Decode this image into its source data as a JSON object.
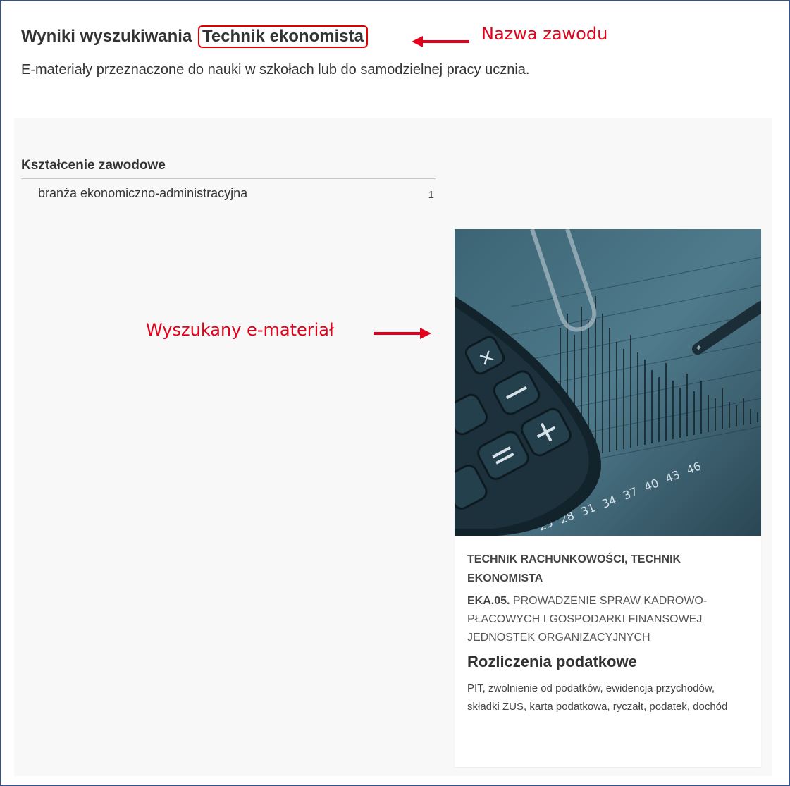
{
  "header": {
    "title_prefix": "Wyniki wyszukiwania",
    "query": "Technik ekonomista",
    "subtitle": "E-materiały przeznaczone do nauki w szkołach lub do samodzielnej pracy ucznia."
  },
  "annotations": {
    "profession_name": "Nazwa zawodu",
    "found_material": "Wyszukany e-materiał",
    "color": "#e3001b"
  },
  "filters": {
    "title": "Kształcenie zawodowe",
    "items": [
      {
        "label": "branża ekonomiczno-administracyjna",
        "count": "1"
      }
    ]
  },
  "card": {
    "image_icon": "calculator-chart-photo",
    "image_numbers": [
      "25",
      "28",
      "31",
      "34",
      "37",
      "40",
      "43",
      "46"
    ],
    "professions": "TECHNIK RACHUNKOWOŚCI, TECHNIK EKONOMISTA",
    "qualification_code": "EKA.05.",
    "qualification_name": "PROWADZENIE SPRAW KADROWO-PŁACOWYCH I GOSPODARKI FINANSOWEJ JEDNOSTEK ORGANIZACYJNYCH",
    "title": "Rozliczenia podatkowe",
    "tags": "PIT, zwolnienie od podatków, ewidencja przychodów, składki ZUS, karta podatkowa, ryczałt, podatek, dochód"
  },
  "colors": {
    "frame": "#2f5496",
    "highlight": "#e00000",
    "panel": "#f8f8f8",
    "image_tint": "#2e4d5c"
  }
}
